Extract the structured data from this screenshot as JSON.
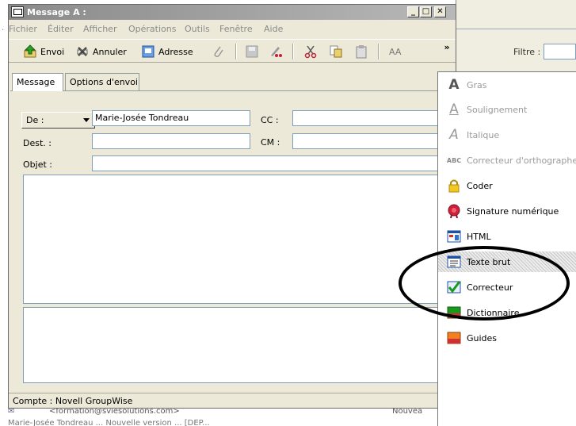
{
  "window": {
    "title": "Message A :"
  },
  "title_buttons": {
    "minimize": "_",
    "maximize": "□",
    "close": "✕"
  },
  "menubar": [
    "Fichier",
    "Éditer",
    "Afficher",
    "Opérations",
    "Outils",
    "Fenêtre",
    "Aide"
  ],
  "toolbar": {
    "send_label": "Envoi",
    "cancel_label": "Annuler",
    "address_label": "Adresse",
    "font_label": "AA",
    "overflow_label": "»"
  },
  "tabs": [
    "Message",
    "Options d'envoi"
  ],
  "form": {
    "from_label": "De :",
    "from_value": "Marie-Josée Tondreau",
    "to_label": "Dest. :",
    "cc_label": "CC :",
    "bcc_label": "CM :",
    "subject_label": "Objet :"
  },
  "status": {
    "account": "Compte : Novell GroupWise"
  },
  "background": {
    "filter_label": "Filtre :",
    "row1_text": "<formation@sviesolutions.com>",
    "row1_status": "Nouvea",
    "row2_text": "Marie-Josée Tondreau  ...  Nouvelle version ...  [DEP..."
  },
  "dropdown_menu": {
    "items": [
      {
        "label": "Gras",
        "icon": "bold-icon",
        "enabled": false
      },
      {
        "label": "Soulignement",
        "icon": "underline-icon",
        "enabled": false
      },
      {
        "label": "Italique",
        "icon": "italic-icon",
        "enabled": false
      },
      {
        "label": "Correcteur d'orthographe",
        "icon": "spellcheck-icon",
        "enabled": false
      },
      {
        "label": "Coder",
        "icon": "lock-icon",
        "enabled": true
      },
      {
        "label": "Signature numérique",
        "icon": "seal-icon",
        "enabled": true
      },
      {
        "label": "HTML",
        "icon": "html-icon",
        "enabled": true
      },
      {
        "label": "Texte brut",
        "icon": "plain-text-icon",
        "enabled": true,
        "highlighted": true
      },
      {
        "label": "Correcteur",
        "icon": "checkmark-icon",
        "enabled": true
      },
      {
        "label": "Dictionnaire",
        "icon": "dictionary-icon",
        "enabled": true
      },
      {
        "label": "Guides",
        "icon": "guides-icon",
        "enabled": true
      }
    ]
  },
  "colors": {
    "accent_green": "#2aa52a",
    "title_gray": "#8a8a8a",
    "window_bg": "#ece9d8",
    "annotation": "#000000"
  }
}
